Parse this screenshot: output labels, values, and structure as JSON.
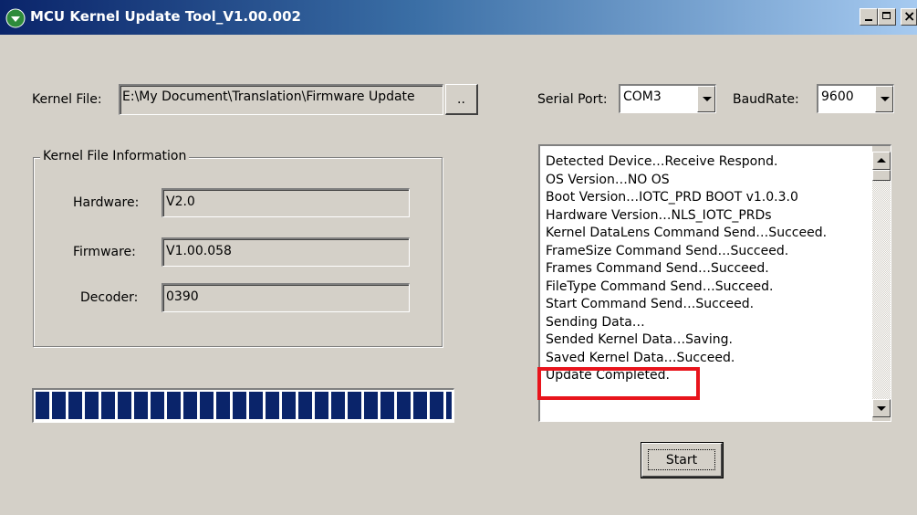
{
  "window": {
    "title": "MCU Kernel Update Tool_V1.00.002"
  },
  "kernel_file": {
    "label": "Kernel File:",
    "path": "E:\\My Document\\Translation\\Firmware Update",
    "browse_label": ".."
  },
  "serial": {
    "port_label": "Serial Port:",
    "port_value": "COM3",
    "baud_label": "BaudRate:",
    "baud_value": "9600"
  },
  "info_group": {
    "title": "Kernel File Information",
    "hardware_label": "Hardware:",
    "hardware_value": "V2.0",
    "firmware_label": "Firmware:",
    "firmware_value": "V1.00.058",
    "decoder_label": "Decoder:",
    "decoder_value": "0390"
  },
  "progress": {
    "fraction": 1.0
  },
  "log": {
    "lines": [
      "Detected Device…Receive Respond.",
      "OS Version…NO OS",
      "Boot Version…IOTC_PRD BOOT v1.0.3.0",
      "Hardware Version…NLS_IOTC_PRDs",
      "Kernel DataLens Command Send…Succeed.",
      "FrameSize Command Send…Succeed.",
      "Frames Command Send…Succeed.",
      "FileType Command Send…Succeed.",
      "Start Command Send…Succeed.",
      "Sending Data…",
      "Sended Kernel Data…Saving.",
      "Saved Kernel Data…Succeed.",
      "Update Completed."
    ]
  },
  "actions": {
    "start_label": "Start"
  },
  "colors": {
    "highlight": "#e8141c",
    "progress": "#0a246a"
  },
  "icons": {
    "app": "app-icon",
    "minimize": "minimize-icon",
    "maximize": "maximize-icon",
    "close": "close-icon"
  }
}
